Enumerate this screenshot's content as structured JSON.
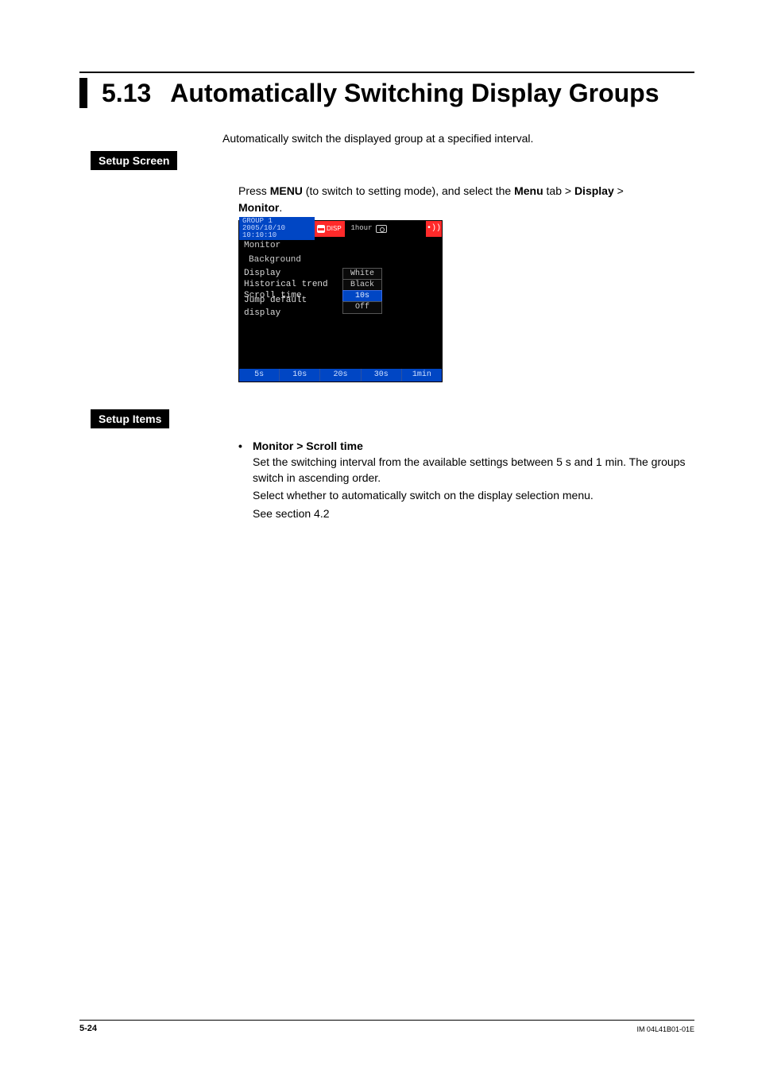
{
  "section_number": "5.13",
  "section_title": "Automatically Switching Display Groups",
  "intro": "Automatically switch the displayed group at a specified interval.",
  "labels": {
    "setup_screen": "Setup Screen",
    "setup_items": "Setup Items"
  },
  "setup_screen_text": {
    "prefix": "Press ",
    "menu_word": "MENU",
    "middle": " (to switch to setting mode), and select the ",
    "menu_tab": "Menu",
    "tab_suffix": " tab > ",
    "display_word": "Display",
    "gt": " > ",
    "monitor_word": "Monitor",
    "period": "."
  },
  "device": {
    "top_group": "GROUP 1",
    "top_datetime": "2005/10/10 10:10:10",
    "disp_label": "DISP",
    "time_label": "1hour",
    "menu_title": "Monitor",
    "category": "Background",
    "rows": [
      {
        "label": "Display",
        "value": "White",
        "selected": false
      },
      {
        "label": "Historical trend",
        "value": "Black",
        "selected": false
      },
      {
        "label": "Scroll time",
        "value": "10s",
        "selected": true
      },
      {
        "label": "Jump default display",
        "value": "Off",
        "selected": false
      }
    ],
    "bottom_options": [
      "5s",
      "10s",
      "20s",
      "30s",
      "1min"
    ]
  },
  "setup_items": {
    "bullet_heading": "Monitor > Scroll time",
    "p1": "Set the switching interval from the available settings between 5 s and 1 min. The groups switch in ascending order.",
    "p2": "Select whether to automatically switch on the display selection menu.",
    "p3": "See section 4.2"
  },
  "footer": {
    "page": "5-24",
    "doc": "IM 04L41B01-01E"
  }
}
